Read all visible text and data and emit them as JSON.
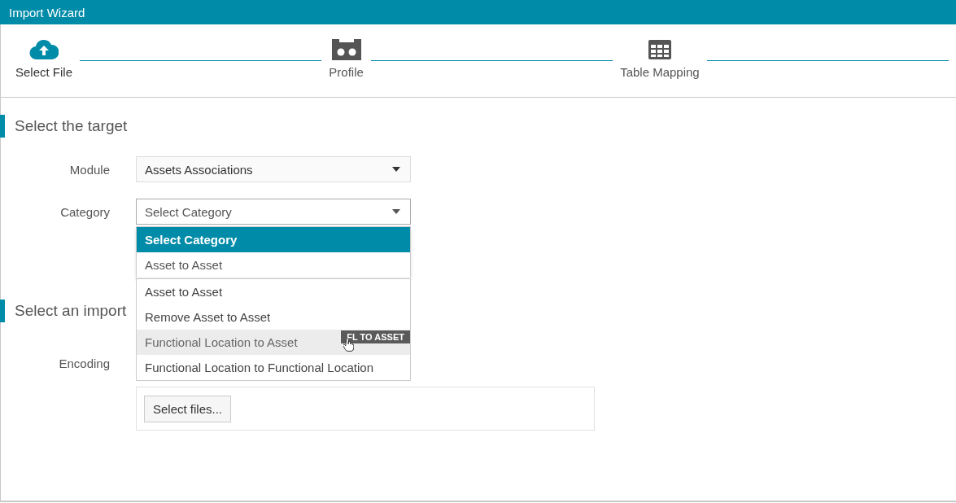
{
  "window": {
    "title": "Import Wizard"
  },
  "steps": [
    {
      "label": "Select File",
      "active": true
    },
    {
      "label": "Profile",
      "active": false
    },
    {
      "label": "Table Mapping",
      "active": false
    }
  ],
  "sections": [
    {
      "title": "Select the target"
    },
    {
      "title": "Select an import"
    }
  ],
  "module": {
    "label": "Module",
    "value": "Assets Associations"
  },
  "category": {
    "label": "Category",
    "value": "Select Category"
  },
  "category_list": [
    {
      "label": "Select Category",
      "selected": true
    },
    {
      "label": "Asset to Asset",
      "selected": false
    }
  ],
  "category_list_2": [
    {
      "label": "Asset to Asset",
      "hovered": false
    },
    {
      "label": "Remove Asset to Asset",
      "hovered": false
    },
    {
      "label": "Functional Location to Asset",
      "hovered": true,
      "badge": "FL TO ASSET"
    },
    {
      "label": "Functional Location to Functional Location",
      "hovered": false
    }
  ],
  "encoding": {
    "label": "Encoding"
  },
  "files_button": "Select files..."
}
